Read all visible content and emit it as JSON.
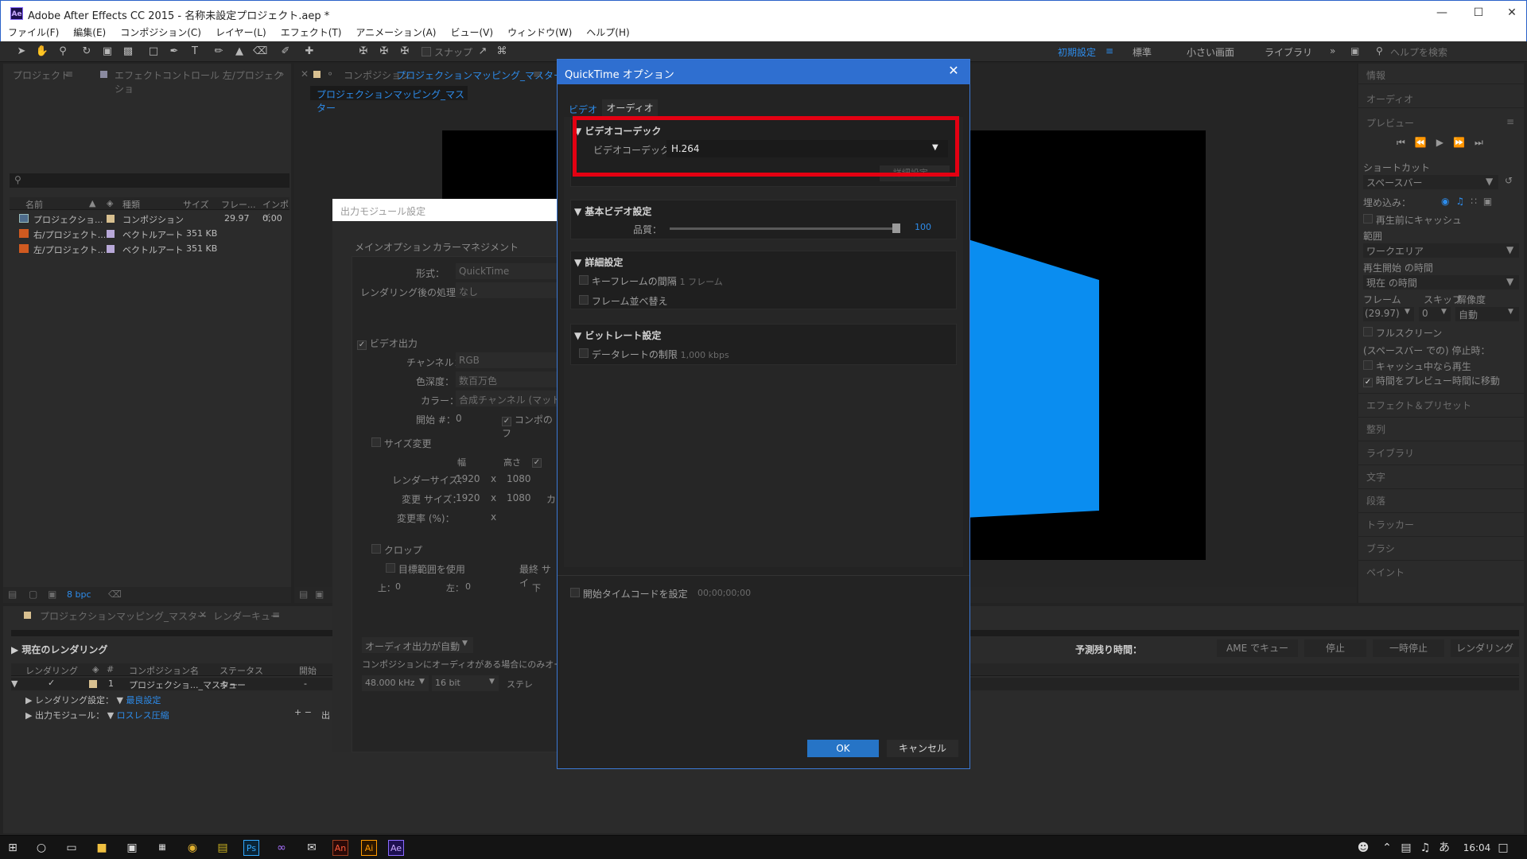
{
  "window": {
    "title": "Adobe After Effects CC 2015 - 名称未設定プロジェクト.aep *",
    "logo": "Ae"
  },
  "menus": [
    "ファイル(F)",
    "編集(E)",
    "コンポジション(C)",
    "レイヤー(L)",
    "エフェクト(T)",
    "アニメーション(A)",
    "ビュー(V)",
    "ウィンドウ(W)",
    "ヘルプ(H)"
  ],
  "toolbar": {
    "snap": "スナップ",
    "workspaces": [
      "初期設定",
      "標準",
      "小さい画面",
      "ライブラリ"
    ],
    "help_placeholder": "ヘルプを検索"
  },
  "project_panel": {
    "tabs": [
      "プロジェクト",
      "エフェクトコントロール 左/プロジェクショ"
    ],
    "columns": [
      "名前",
      "種類",
      "サイズ",
      "フレー...",
      "インポイ"
    ],
    "rows": [
      {
        "name": "プロジェクショ...",
        "type": "コンポジション",
        "size": "",
        "fps": "29.97",
        "in": "0;00"
      },
      {
        "name": "右/プロジェクト...",
        "type": "ベクトルアート",
        "size": "351 KB",
        "fps": "",
        "in": ""
      },
      {
        "name": "左/プロジェクト...",
        "type": "ベクトルアート",
        "size": "351 KB",
        "fps": "",
        "in": ""
      }
    ],
    "bpc": "8 bpc"
  },
  "comp_panel": {
    "tab_prefix": "コンポジション",
    "tab_name": "プロジェクションマッピング_マスター",
    "subtab": "プロジェクションマッピング_マスター"
  },
  "output_module": {
    "title": "出力モジュール設定",
    "tabs": [
      "メインオプション",
      "カラーマネジメント"
    ],
    "format_label": "形式：",
    "format_value": "QuickTime",
    "post_label": "レンダリング後の処理：",
    "post_value": "なし",
    "video_output": "ビデオ出力",
    "channel_label": "チャンネル：",
    "channel_value": "RGB",
    "depth_label": "色深度：",
    "depth_value": "数百万色",
    "color_label": "カラー：",
    "color_value": "合成チャンネル (マットあ",
    "start_label": "開始 #：",
    "start_value": "0",
    "comp_frame": "コンポのフ",
    "resize": "サイズ変更",
    "width_h": "幅",
    "height_h": "高さ",
    "render_size_label": "レンダーサイズ：",
    "render_w": "1920",
    "render_h": "1080",
    "resize_to_label": "変更 サイズ：",
    "resize_w": "1920",
    "resize_h": "1080",
    "resize_extra": "カ",
    "resize_pct_label": "変更率 (%)：",
    "x": "x",
    "crop": "クロップ",
    "roi": "目標範囲を使用",
    "final_size": "最終 サイ",
    "top_label": "上：",
    "top_value": "0",
    "left_label": "左：",
    "left_value": "0",
    "bottom_label": "下",
    "audio_auto": "オーディオ出力が自動",
    "audio_note": "コンポジションにオーディオがある場合にのみオーディ",
    "rate": "48.000 kHz",
    "bits": "16 bit",
    "stereo": "ステレ"
  },
  "dialog": {
    "title": "QuickTime オプション",
    "tabs": [
      "ビデオ",
      "オーディオ"
    ],
    "codec_section": "ビデオコーデック",
    "codec_label": "ビデオコーデック：",
    "codec_value": "H.264",
    "detail_btn": "詳細設定...",
    "basic_section": "基本ビデオ設定",
    "quality_label": "品質：",
    "quality_value": "100",
    "quality": 100,
    "advanced_section": "詳細設定",
    "keyframe_label": "キーフレームの間隔",
    "keyframe_value": "1 フレーム",
    "reorder_label": "フレーム並べ替え",
    "bitrate_section": "ビットレート設定",
    "datarate_label": "データレートの制限",
    "datarate_value": "1,000 kbps",
    "timecode_label": "開始タイムコードを設定",
    "timecode_value": "00;00;00;00",
    "ok": "OK",
    "cancel": "キャンセル"
  },
  "right_panel": {
    "sections": [
      "情報",
      "オーディオ",
      "プレビュー"
    ],
    "shortcut_label": "ショートカット",
    "shortcut_value": "スペースバー",
    "include_label": "埋め込み：",
    "cache_before": "再生前にキャッシュ",
    "range_label": "範囲",
    "range_value": "ワークエリア",
    "start_time_label": "再生開始 の時間",
    "start_time_value": "現在 の時間",
    "frame_label": "フレーム",
    "skip_label": "スキップ",
    "res_label": "解像度",
    "frame_value": "(29.97)",
    "skip_value": "0",
    "res_value": "自動",
    "fullscreen": "フルスクリーン",
    "stop_label": "(スペースバー での) 停止時：",
    "play_cached": "キャッシュ中なら再生",
    "move_time": "時間をプレビュー時間に移動",
    "more": [
      "エフェクト＆プリセット",
      "整列",
      "ライブラリ",
      "文字",
      "段落",
      "トラッカー",
      "ブラシ",
      "ペイント"
    ]
  },
  "render_queue": {
    "tabs": [
      "プロジェクションマッピング_マスター",
      "レンダーキュー"
    ],
    "current": "現在のレンダリング",
    "remaining": "予測残り時間：",
    "buttons": [
      "AME でキュー",
      "停止",
      "一時停止",
      "レンダリング"
    ],
    "columns": [
      "レンダリング",
      "#",
      "コンポジション名",
      "ステータス",
      "開始"
    ],
    "row": {
      "num": "1",
      "comp": "プロジェクショ..._マスター",
      "status": "キュー",
      "start": "-"
    },
    "settings_label": "レンダリング設定：",
    "settings_value": "最良設定",
    "module_label": "出力モジュール：",
    "module_value": "ロスレス圧縮",
    "out_prefix": "出"
  },
  "taskbar": {
    "time": "16:04",
    "ime": "あ"
  }
}
